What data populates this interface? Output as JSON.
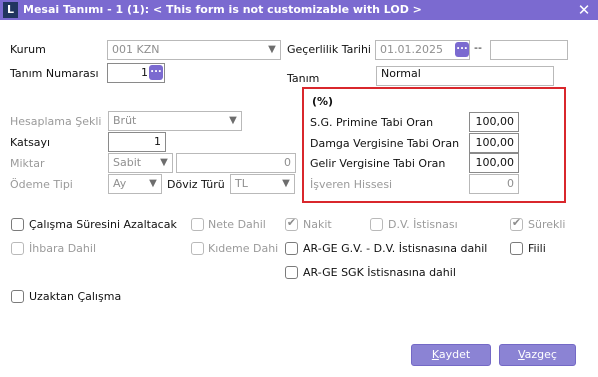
{
  "window": {
    "title": "Mesai Tanımı - 1 (1): < This form is not customizable with LOD >",
    "logo": "L",
    "close_glyph": "✕"
  },
  "form": {
    "kurum_label": "Kurum",
    "kurum_value": "001 KZN",
    "tanim_numarasi_label": "Tanım Numarası",
    "tanim_numarasi_value": "1",
    "gecerlilik_label": "Geçerlilik Tarihi",
    "gecerlilik_value": "01.01.2025",
    "gecerlilik_sep": "--",
    "tanim_label": "Tanım",
    "tanim_value": "Normal",
    "hesaplama_label": "Hesaplama Şekli",
    "hesaplama_value": "Brüt",
    "katsayi_label": "Katsayı",
    "katsayi_value": "1",
    "miktar_label": "Miktar",
    "miktar_type": "Sabit",
    "miktar_value": "0",
    "odeme_label": "Ödeme Tipi",
    "odeme_value": "Ay",
    "doviz_label": "Döviz Türü",
    "doviz_value": "TL",
    "dots": "..."
  },
  "rates": {
    "header": "(%)",
    "sg_label": "S.G. Primine Tabi Oran",
    "sg_value": "100,00",
    "damga_label": "Damga Vergisine Tabi Oran",
    "damga_value": "100,00",
    "gelir_label": "Gelir Vergisine Tabi Oran",
    "gelir_value": "100,00",
    "isveren_label": "İşveren Hissesi",
    "isveren_value": "0"
  },
  "checkboxes": {
    "calisma": "Çalışma Süresini Azaltacak",
    "nete": "Nete Dahil",
    "nakit": "Nakit",
    "dv": "D.V. İstisnası",
    "surekli": "Sürekli",
    "ihbara": "İhbara Dahil",
    "kideme": "Kıdeme Dahi",
    "arge_gv": "AR-GE G.V. - D.V. İstisnasına dahil",
    "fiili": "Fiili",
    "arge_sgk": "AR-GE SGK İstisnasına dahil",
    "uzaktan": "Uzaktan Çalışma"
  },
  "buttons": {
    "kaydet_first": "K",
    "kaydet_rest": "aydet",
    "vazgec_first": "V",
    "vazgec_rest": "azgeç"
  },
  "colors": {
    "accent": "#7b6ad0",
    "button": "#8b83d4",
    "highlight_frame": "#d9272c"
  }
}
